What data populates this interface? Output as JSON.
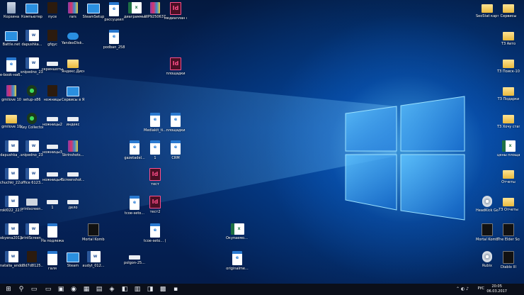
{
  "desktop": {
    "icons": [
      {
        "label": "Корзина",
        "glyph": "",
        "kind": "recycle",
        "col": 0,
        "row": 0
      },
      {
        "label": "Компьютер",
        "glyph": "",
        "kind": "computer",
        "col": 1,
        "row": 0
      },
      {
        "label": "пусе",
        "glyph": "",
        "kind": "game",
        "col": 2,
        "row": 0
      },
      {
        "label": "rars",
        "glyph": "",
        "kind": "winrar",
        "col": 3,
        "row": 0
      },
      {
        "label": "SteamSetup",
        "glyph": "",
        "kind": "computer",
        "col": 4,
        "row": 0
      },
      {
        "label": "рэссуцеил",
        "glyph": "e",
        "kind": "edge",
        "col": 5,
        "row": 0
      },
      {
        "label": "диаграммы",
        "glyph": "x",
        "kind": "excel",
        "col": 6,
        "row": 0
      },
      {
        "label": "WP9250637",
        "glyph": "",
        "kind": "winrar",
        "col": 7,
        "row": 0
      },
      {
        "label": "медиаплан общий",
        "glyph": "Id",
        "kind": "indesign",
        "col": 8,
        "row": 0
      },
      {
        "label": "Battle.net",
        "glyph": "",
        "kind": "computer",
        "col": 0,
        "row": 1
      },
      {
        "label": "dapushka...",
        "glyph": "w",
        "kind": "word",
        "col": 1,
        "row": 1
      },
      {
        "label": "gfqyc",
        "glyph": "",
        "kind": "game",
        "col": 2,
        "row": 1
      },
      {
        "label": "YandexDisk...",
        "glyph": "",
        "kind": "cloud",
        "col": 3,
        "row": 1
      },
      {
        "label": "podban_258",
        "glyph": "e",
        "kind": "edge",
        "col": 5,
        "row": 1
      },
      {
        "label": "e-book-наб...",
        "glyph": "e",
        "kind": "edge",
        "col": 0,
        "row": 2
      },
      {
        "label": "snipedno_23...",
        "glyph": "w",
        "kind": "word",
        "col": 1,
        "row": 2
      },
      {
        "label": "скриншоты",
        "glyph": "",
        "kind": "strip",
        "col": 2,
        "row": 2
      },
      {
        "label": "Яндекс.Диск",
        "glyph": "",
        "kind": "folder",
        "col": 3,
        "row": 2
      },
      {
        "label": "площадки",
        "glyph": "Id",
        "kind": "indesign",
        "col": 8,
        "row": 2
      },
      {
        "label": "gmilove 10",
        "glyph": "",
        "kind": "winrar",
        "col": 0,
        "row": 3
      },
      {
        "label": "setup-x86",
        "glyph": "●",
        "kind": "green",
        "col": 1,
        "row": 3
      },
      {
        "label": "ножницы",
        "glyph": "",
        "kind": "game",
        "col": 2,
        "row": 3
      },
      {
        "label": "Сервисы в Яндекс.Д...",
        "glyph": "",
        "kind": "computer",
        "col": 3,
        "row": 3
      },
      {
        "label": "gmilove 10",
        "glyph": "",
        "kind": "folder",
        "col": 0,
        "row": 4
      },
      {
        "label": "Key Collector",
        "glyph": "●",
        "kind": "green",
        "col": 1,
        "row": 4
      },
      {
        "label": "ножницы2",
        "glyph": "",
        "kind": "strip",
        "col": 2,
        "row": 4
      },
      {
        "label": "индекс",
        "glyph": "",
        "kind": "strip",
        "col": 3,
        "row": 4
      },
      {
        "label": "Mediakit_ti...",
        "glyph": "e",
        "kind": "edge",
        "col": 7,
        "row": 4
      },
      {
        "label": "площадки",
        "glyph": "e",
        "kind": "edge",
        "col": 8,
        "row": 4
      },
      {
        "label": "dapushka_...",
        "glyph": "w",
        "kind": "word",
        "col": 0,
        "row": 5
      },
      {
        "label": "snipedno_23...",
        "glyph": "w",
        "kind": "word",
        "col": 1,
        "row": 5
      },
      {
        "label": "ножницы3",
        "glyph": "",
        "kind": "strip",
        "col": 2,
        "row": 5
      },
      {
        "label": "Skrinshots...",
        "glyph": "",
        "kind": "winrar",
        "col": 3,
        "row": 5
      },
      {
        "label": "gazetadel...",
        "glyph": "e",
        "kind": "edge",
        "col": 6,
        "row": 5
      },
      {
        "label": "1",
        "glyph": "e",
        "kind": "edge",
        "col": 7,
        "row": 5
      },
      {
        "label": "CRM",
        "glyph": "e",
        "kind": "edge",
        "col": 8,
        "row": 5
      },
      {
        "label": "chuchki_22...",
        "glyph": "w",
        "kind": "word",
        "col": 0,
        "row": 6
      },
      {
        "label": "office 6123...",
        "glyph": "w",
        "kind": "word",
        "col": 1,
        "row": 6
      },
      {
        "label": "ножницы4",
        "glyph": "",
        "kind": "strip",
        "col": 2,
        "row": 6
      },
      {
        "label": "Screenshot...",
        "glyph": "",
        "kind": "strip",
        "col": 3,
        "row": 6
      },
      {
        "label": "тест",
        "glyph": "Id",
        "kind": "indesign",
        "col": 7,
        "row": 6
      },
      {
        "label": "rokl022_22...",
        "glyph": "w",
        "kind": "word",
        "col": 0,
        "row": 7
      },
      {
        "label": "printscreen...",
        "glyph": "",
        "kind": "drive",
        "col": 1,
        "row": 7
      },
      {
        "label": "1",
        "glyph": "",
        "kind": "strip",
        "col": 2,
        "row": 7
      },
      {
        "label": "дело",
        "glyph": "",
        "kind": "strip",
        "col": 3,
        "row": 7
      },
      {
        "label": "tcoe-seto...",
        "glyph": "e",
        "kind": "edge",
        "col": 6,
        "row": 7
      },
      {
        "label": "тест2",
        "glyph": "Id",
        "kind": "indesign",
        "col": 7,
        "row": 7
      },
      {
        "label": "obyena2013...",
        "glyph": "w",
        "kind": "word",
        "col": 0,
        "row": 8
      },
      {
        "label": "printScreen...",
        "glyph": "w",
        "kind": "word",
        "col": 1,
        "row": 8
      },
      {
        "label": "На подлежаще...",
        "glyph": "",
        "kind": "edge",
        "col": 2,
        "row": 8
      },
      {
        "label": "Mortal Kombat X",
        "glyph": "",
        "kind": "dark",
        "col": 4,
        "row": 8
      },
      {
        "label": "tcoe-seto... (1)",
        "glyph": "e",
        "kind": "edge",
        "col": 7,
        "row": 8
      },
      {
        "label": "Окупаемо... Подарки",
        "glyph": "x",
        "kind": "excel",
        "col": 11,
        "row": 8
      },
      {
        "label": "natalia_and...",
        "glyph": "w",
        "kind": "word",
        "col": 0,
        "row": 9
      },
      {
        "label": "d8d7d8125...",
        "glyph": "",
        "kind": "game",
        "col": 1,
        "row": 9
      },
      {
        "label": "галя",
        "glyph": "",
        "kind": "edge",
        "col": 2,
        "row": 9
      },
      {
        "label": "Steam",
        "glyph": "",
        "kind": "computer",
        "col": 3,
        "row": 9
      },
      {
        "label": "audyt_012...",
        "glyph": "w",
        "kind": "word",
        "col": 4,
        "row": 9
      },
      {
        "label": "polgon-25...",
        "glyph": "",
        "kind": "strip",
        "col": 6,
        "row": 9
      },
      {
        "label": "originalme...",
        "glyph": "e",
        "kind": "edge",
        "col": 11,
        "row": 9
      }
    ],
    "right_icons": [
      {
        "label": "SeoStat карт 2017",
        "glyph": "",
        "kind": "folder",
        "col": 0,
        "row": 0
      },
      {
        "label": "Сервисы",
        "glyph": "",
        "kind": "folder",
        "col": 1,
        "row": 0
      },
      {
        "label": "ТЗ Авто",
        "glyph": "",
        "kind": "folder",
        "col": 1,
        "row": 1
      },
      {
        "label": "ТЗ Поиск-10",
        "glyph": "",
        "kind": "folder",
        "col": 1,
        "row": 2
      },
      {
        "label": "ТЗ Подарки",
        "glyph": "",
        "kind": "folder",
        "col": 1,
        "row": 3
      },
      {
        "label": "ТЗ Хочу статьи",
        "glyph": "",
        "kind": "folder",
        "col": 1,
        "row": 4
      },
      {
        "label": "цены площадок",
        "glyph": "x",
        "kind": "excel",
        "col": 1,
        "row": 5
      },
      {
        "label": "Отчеты",
        "glyph": "",
        "kind": "folder",
        "col": 1,
        "row": 6
      },
      {
        "label": "HeadKick Gods Ama...",
        "glyph": "",
        "kind": "disk",
        "col": 0,
        "row": 7
      },
      {
        "label": "ТЗ Отчеты",
        "glyph": "",
        "kind": "folder",
        "col": 1,
        "row": 7
      },
      {
        "label": "Mortal Kombat...",
        "glyph": "",
        "kind": "dark",
        "col": 0,
        "row": 8
      },
      {
        "label": "The Elder Scrolls...",
        "glyph": "",
        "kind": "dark",
        "col": 1,
        "row": 8
      },
      {
        "label": "Rubix",
        "glyph": "",
        "kind": "disk",
        "col": 0,
        "row": 9
      },
      {
        "label": "Diablo III",
        "glyph": "",
        "kind": "dark",
        "col": 1,
        "row": 9
      }
    ]
  },
  "taskbar": {
    "start": "⊞",
    "search": "⚲",
    "taskview": "▭",
    "pinned": [
      "▭",
      "▣",
      "◉",
      "▦",
      "▤",
      "◈",
      "◧",
      "▥",
      "◨",
      "▩",
      "▪"
    ],
    "tray": "⌃ ◐ ♪",
    "lang": "РУС",
    "time": "20:05",
    "date": "06.03.2017"
  }
}
